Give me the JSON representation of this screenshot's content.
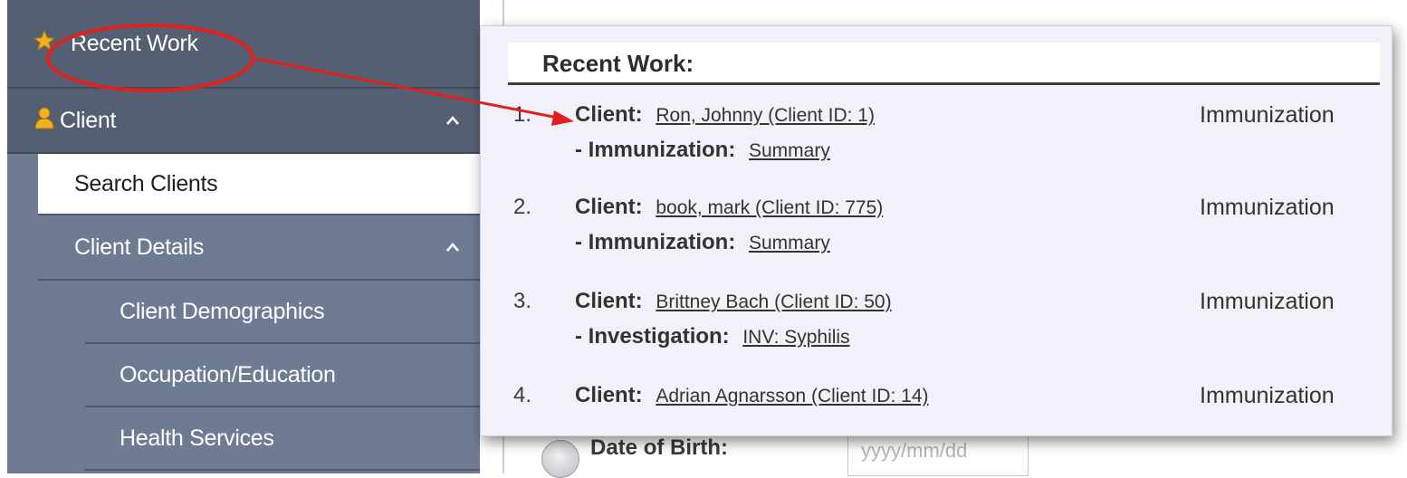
{
  "sidebar": {
    "recent_work": "Recent Work",
    "client": "Client",
    "search_clients": "Search Clients",
    "client_details": "Client Details",
    "client_demographics": "Client Demographics",
    "occupation_education": "Occupation/Education",
    "health_services": "Health Services"
  },
  "form": {
    "dob_label": "Date of Birth:",
    "dob_placeholder": "yyyy/mm/dd"
  },
  "popup": {
    "title": "Recent Work:",
    "client_label": "Client:",
    "items": [
      {
        "num": "1.",
        "client": "Ron, Johnny (Client ID: 1)",
        "sub_label": "- Immunization:",
        "sub_link": "Summary",
        "type": "Immunization"
      },
      {
        "num": "2.",
        "client": "book, mark (Client ID: 775)",
        "sub_label": "- Immunization:",
        "sub_link": "Summary",
        "type": "Immunization"
      },
      {
        "num": "3.",
        "client": "Brittney Bach (Client ID: 50)",
        "sub_label": "- Investigation:",
        "sub_link": "INV: Syphilis",
        "type": "Immunization"
      },
      {
        "num": "4.",
        "client": "Adrian Agnarsson (Client ID: 14)",
        "type": "Immunization"
      }
    ]
  },
  "icons": {
    "recent_work": "star-icon",
    "client": "user-icon",
    "expand": "chevron-up-icon"
  },
  "colors": {
    "sidebar_dark": "#555f73",
    "sidebar_light": "#6e7b93",
    "popup_bg": "#f2f1f9",
    "annotation": "#e0201c",
    "star": "#f2b21a"
  }
}
